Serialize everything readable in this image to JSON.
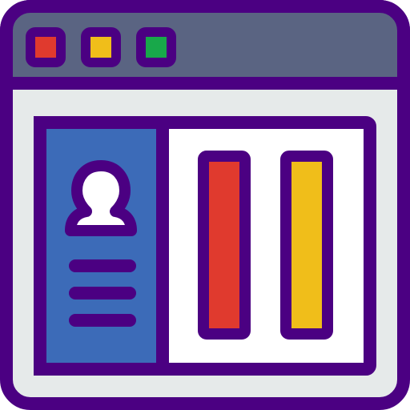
{
  "colors": {
    "outline": "#4B0082",
    "titlebar": "#5A6482",
    "window_body": "#E6EAEA",
    "panel_bg": "#FFFFFF",
    "sidebar": "#3C6BB8",
    "avatar": "#FFFFFF",
    "dot_red": "#E03A2E",
    "dot_yellow": "#F0BE1A",
    "dot_green": "#18A84A",
    "bar_red": "#E03A2E",
    "bar_yellow": "#F0BE1A"
  },
  "icons": {
    "window": "browser-window-icon",
    "controls": [
      "close-dot-icon",
      "minimize-dot-icon",
      "maximize-dot-icon"
    ],
    "profile": "user-avatar-icon",
    "menu": "text-lines-icon"
  }
}
